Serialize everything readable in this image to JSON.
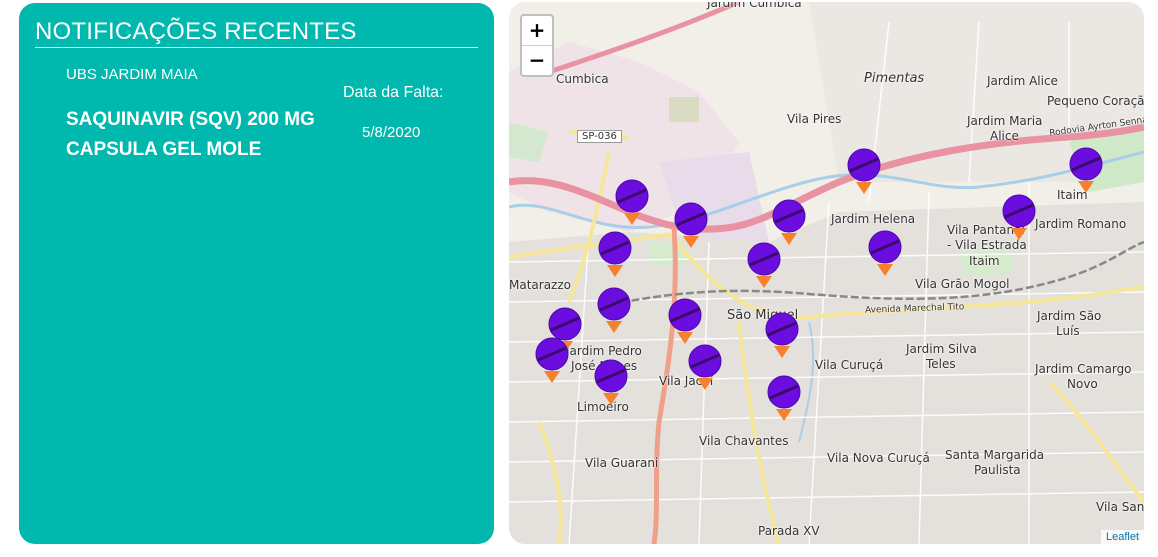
{
  "panel": {
    "title": "NOTIFICAÇÕES RECENTES",
    "unit": "UBS JARDIM MAIA",
    "drug": "SAQUINAVIR (SQV) 200 MG CAPSULA GEL MOLE",
    "date_label": "Data da Falta:",
    "date_value": "5/8/2020",
    "background": "#00b8ae"
  },
  "map": {
    "zoom_in": "+",
    "zoom_out": "−",
    "attribution": "Leaflet",
    "marker_color": "#6a0dde",
    "marker_tip_color": "#f7812a",
    "labels": {
      "jardim_cumbica": "Jardim Cumbica",
      "cumbica": "Cumbica",
      "pimentas": "Pimentas",
      "jardim_alice": "Jardim Alice",
      "pequeno_coracao": "Pequeno Coração",
      "vila_pires": "Vila Pires",
      "jardim_maria_alice_1": "Jardim Maria",
      "jardim_maria_alice_2": "Alice",
      "rodovia_ayrton": "Rodovia Ayrton Senna",
      "itaim": "Itaim",
      "jardim_helena": "Jardim Helena",
      "jardim_romano": "Jardim Romano",
      "vila_pantanal_1": "Vila Pantanal",
      "vila_pantanal_2": "- Vila Estrada",
      "vila_pantanal_3": "Itaim",
      "vila_grao_mogol": "Vila Grão Mogol",
      "matarazzo": "Matarazzo",
      "sao_miguel": "São Miguel",
      "jardim_sao_luis_1": "Jardim São",
      "jardim_sao_luis_2": "Luís",
      "jardim_silva_teles_1": "Jardim Silva",
      "jardim_silva_teles_2": "Teles",
      "jardim_pedro_jose_1": "Jardim Pedro",
      "jardim_pedro_jose_2": "José Nunes",
      "vila_curuca": "Vila Curuçá",
      "jardim_camargo_novo_1": "Jardim Camargo",
      "jardim_camargo_novo_2": "Novo",
      "vila_jacui": "Vila Jacuí",
      "limoeiro": "Limoeiro",
      "vila_chavantes": "Vila Chavantes",
      "vila_guarani": "Vila Guarani",
      "vila_nova_curuca": "Vila Nova Curuçá",
      "santa_margarida_1": "Santa Margarida",
      "santa_margarida_2": "Paulista",
      "vila_santa": "Vila Sant",
      "parada_xv": "Parada XV",
      "sp036": "SP-036",
      "avenida_marechal": "Avenida Marechal Tito"
    }
  }
}
